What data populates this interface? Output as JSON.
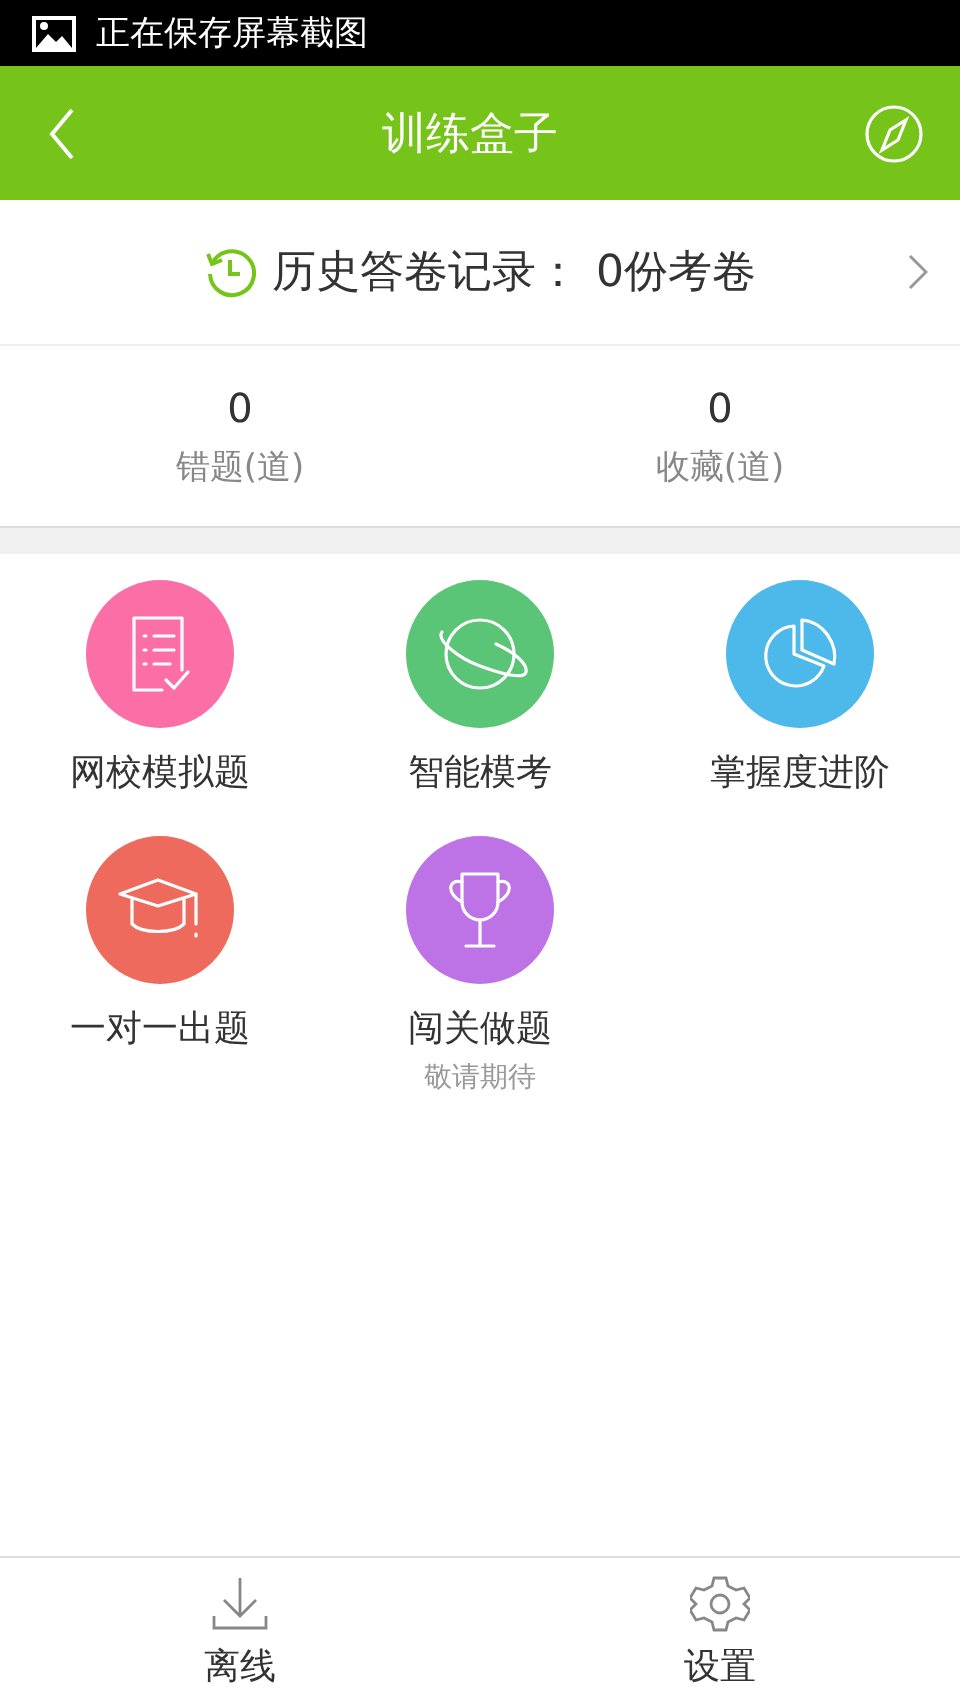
{
  "status_bar": {
    "notification": "正在保存屏幕截图"
  },
  "app_bar": {
    "title": "训练盒子"
  },
  "history": {
    "label": "历史答卷记录：",
    "value": "0份考卷"
  },
  "stats": [
    {
      "value": "0",
      "label": "错题(道)"
    },
    {
      "value": "0",
      "label": "收藏(道)"
    }
  ],
  "features": [
    {
      "label": "网校模拟题",
      "color": "#fc6fa6"
    },
    {
      "label": "智能模考",
      "color": "#5ac477"
    },
    {
      "label": "掌握度进阶",
      "color": "#4db8ea"
    },
    {
      "label": "一对一出题",
      "color": "#ee6a5c"
    },
    {
      "label": "闯关做题",
      "color": "#bd72e6",
      "note": "敬请期待"
    }
  ],
  "bottom_nav": [
    {
      "label": "离线"
    },
    {
      "label": "设置"
    }
  ]
}
